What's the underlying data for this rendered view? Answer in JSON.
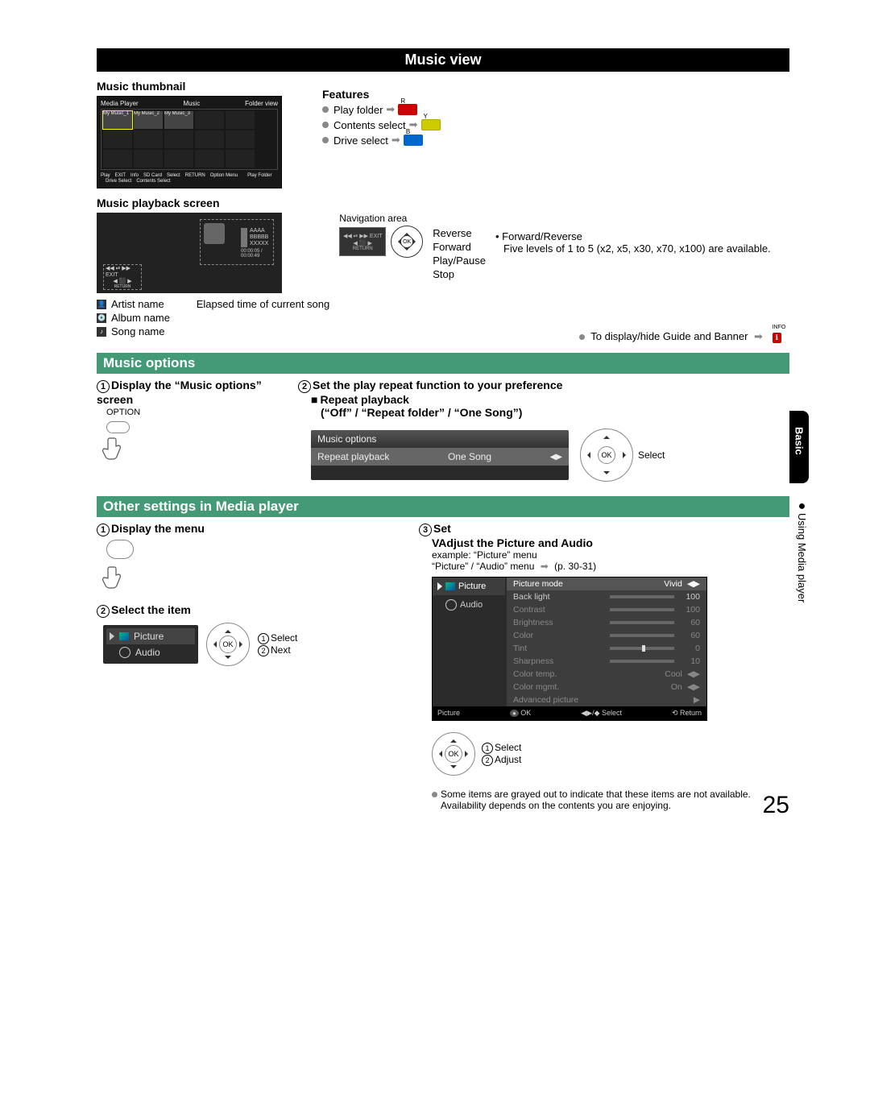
{
  "page_number": "25",
  "side": {
    "section": "Basic",
    "sub": "Using Media player",
    "bullet": "●"
  },
  "music_view": {
    "banner": "Music view",
    "thumb_title": "Music thumbnail",
    "tv": {
      "left": "Media Player",
      "mid": "Music",
      "right": "Folder view",
      "folders": [
        "My Music_1",
        "My Music_2",
        "My Music_3"
      ],
      "footer": [
        "Play",
        "EXIT",
        "Info",
        "SD Card",
        "Select",
        "RETURN",
        "Option Menu",
        "",
        "Play Folder",
        "",
        "Drive Select",
        "Contents Select"
      ]
    },
    "features_title": "Features",
    "features": [
      {
        "label": "Play folder",
        "key": "R",
        "cls": "r"
      },
      {
        "label": "Contents select",
        "key": "Y",
        "cls": "y"
      },
      {
        "label": "Drive select",
        "key": "B",
        "cls": "b"
      }
    ],
    "pb_title": "Music playback screen",
    "pb_meta": {
      "a": "AAAA",
      "b": "BBBBB",
      "c": "XXXXX",
      "t": "00:00:05 / 00:00:49"
    },
    "nav_label": "Navigation area",
    "nav_items": [
      "Reverse",
      "Forward",
      "Play/Pause",
      "Stop"
    ],
    "fr_note1": "• Forward/Reverse",
    "fr_note2": "Five levels of 1 to 5 (x2, x5, x30, x70, x100) are available.",
    "legend": {
      "artist": "Artist name",
      "album": "Album name",
      "song": "Song name",
      "elapsed": "Elapsed time of current song"
    },
    "guide_line": "To display/hide Guide and Banner"
  },
  "music_options": {
    "banner": "Music options",
    "step1": "Display the “Music options” screen",
    "step1_btn": "OPTION",
    "step2": "Set the play repeat function to your preference",
    "repeat_h": "Repeat playback",
    "repeat_opts": "(“Off” / “Repeat folder” / “One Song”)",
    "panel_title": "Music options",
    "panel_row_l": "Repeat playback",
    "panel_row_r": "One Song",
    "select": "Select"
  },
  "other": {
    "banner": "Other settings in Media player",
    "step1": "Display the menu",
    "step2": "Select the item",
    "step2_a": "Select",
    "step2_b": "Next",
    "menu_items": [
      "Picture",
      "Audio"
    ],
    "step3": "Set",
    "step3_sub": "VAdjust the Picture and Audio",
    "example": "example: “Picture” menu",
    "ref": "“Picture” / “Audio” menu",
    "ref_p": "(p. 30-31)",
    "pic_menu": {
      "left": [
        "Picture",
        "Audio"
      ],
      "rows": [
        {
          "l": "Picture mode",
          "r": "Vivid",
          "sel": true,
          "arrow": true
        },
        {
          "l": "Back light",
          "r": "100",
          "bar": 100
        },
        {
          "l": "Contrast",
          "r": "100",
          "bar": 100,
          "dim": true
        },
        {
          "l": "Brightness",
          "r": "60",
          "bar": 60,
          "dim": true
        },
        {
          "l": "Color",
          "r": "60",
          "bar": 60,
          "dim": true
        },
        {
          "l": "Tint",
          "r": "0",
          "bar": 50,
          "dim": true,
          "center": true
        },
        {
          "l": "Sharpness",
          "r": "10",
          "bar": 18,
          "dim": true
        },
        {
          "l": "Color temp.",
          "r": "Cool",
          "dim": true,
          "arrow": true
        },
        {
          "l": "Color mgmt.",
          "r": "On",
          "dim": true,
          "arrow": true
        },
        {
          "l": "Advanced picture",
          "r": "",
          "dim": true,
          "go": true
        }
      ],
      "footer": {
        "l": "Picture",
        "ok": "OK",
        "sel": "Select",
        "ret": "Return"
      }
    },
    "nav_a": "Select",
    "nav_b": "Adjust",
    "note": "Some items are grayed out to indicate that these items are not available. Availability depends on the contents you are enjoying."
  }
}
